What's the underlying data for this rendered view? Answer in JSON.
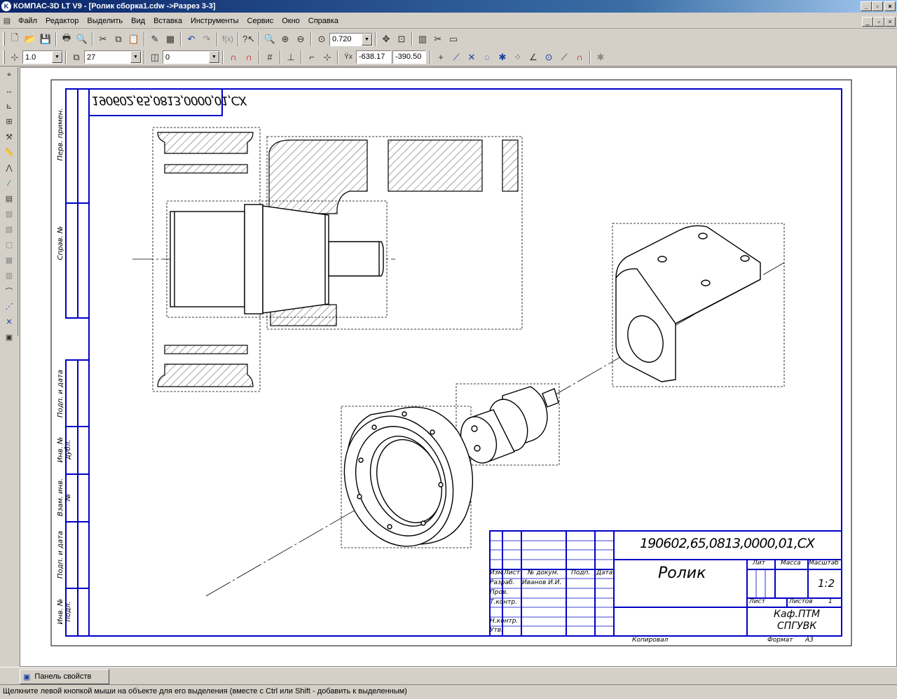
{
  "window": {
    "title": "КОМПАС-3D LT V9 - [Ролик сборка1.cdw ->Разрез 3-3]",
    "logo_letter": "K"
  },
  "menu": [
    "Файл",
    "Редактор",
    "Выделить",
    "Вид",
    "Вставка",
    "Инструменты",
    "Сервис",
    "Окно",
    "Справка"
  ],
  "toolbar": {
    "zoom_value": "0.720",
    "step_value": "1.0",
    "angle_value": "27",
    "layer_value": "0",
    "coord_x": "-638.17",
    "coord_y": "-390.50"
  },
  "drawing": {
    "mirrored_code": "190602,65,0813,0000,01,CX",
    "designation": "190602,65,0813,0000,01,CX",
    "part_name": "Ролик",
    "scale": "1:2",
    "sheet_label": "Лист",
    "sheets_label": "Листов",
    "sheets_count": "1",
    "lit_label": "Лит",
    "mass_label": "Масса",
    "scale_label": "Масштаб",
    "org_line1": "Каф.ПТМ",
    "org_line2": "СПГУВК",
    "copied_label": "Копировал",
    "format_label": "Формат",
    "format_value": "A3",
    "header_izm": "Изм",
    "header_list": "Лист",
    "header_doc": "№ докум.",
    "header_sign": "Подп.",
    "header_date": "Дата",
    "row_razrab": "Разраб.",
    "row_razrab_name": "Иванов И.И.",
    "row_prov": "Пров.",
    "row_tkontr": "Т.контр.",
    "row_nkontr": "Н.контр.",
    "row_utv": "Утв.",
    "side_labels": [
      "Перв. примен.",
      "Справ. №",
      "Подп. и дата",
      "Инв. № дубл.",
      "Взам. инв. №",
      "Подп. и дата",
      "Инв. № подл."
    ]
  },
  "properties_tab": "Панель свойств",
  "status_text": "Щелкните левой кнопкой мыши на объекте для его выделения (вместе с Ctrl или Shift - добавить к выделенным)"
}
